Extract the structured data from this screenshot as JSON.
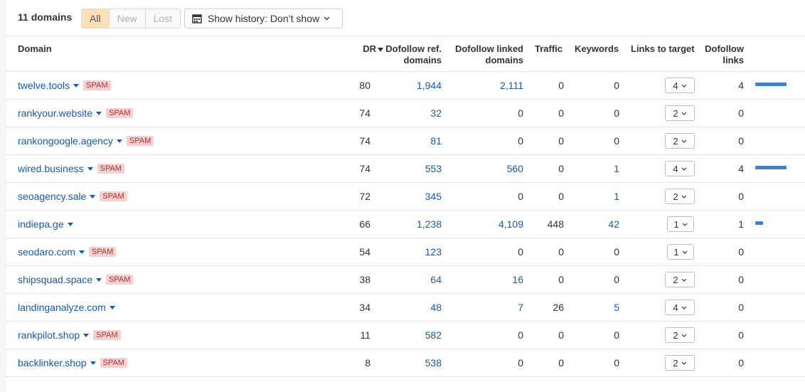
{
  "header": {
    "count_label": "11 domains",
    "filters": [
      {
        "label": "All",
        "active": true
      },
      {
        "label": "New",
        "active": false
      },
      {
        "label": "Lost",
        "active": false
      }
    ],
    "history_label": "Show history: Don’t show",
    "history_icon": "calendar-icon"
  },
  "columns": {
    "domain": "Domain",
    "dr": "DR",
    "dofollow_ref_domains_1": "Dofollow ref.",
    "dofollow_ref_domains_2": "domains",
    "dofollow_linked_domains_1": "Dofollow linked",
    "dofollow_linked_domains_2": "domains",
    "traffic": "Traffic",
    "keywords": "Keywords",
    "links_to_target": "Links to target",
    "dofollow_links_1": "Dofollow",
    "dofollow_links_2": "links"
  },
  "colors": {
    "link": "#1a5aa6",
    "spam_bg": "#f6d0d0",
    "active_filter_bg": "#fce0b5",
    "bar": "#3d84cc"
  },
  "rows": [
    {
      "domain": "twelve.tools",
      "spam": "SPAM",
      "dr": "80",
      "ref": "1,944",
      "linked": "2,111",
      "traffic": "0",
      "keywords": "0",
      "links_to_target": "4",
      "dofollow_links": "4",
      "dofollow_bar_fraction": 1.0
    },
    {
      "domain": "rankyour.website",
      "spam": "SPAM",
      "dr": "74",
      "ref": "32",
      "linked": "0",
      "traffic": "0",
      "keywords": "0",
      "links_to_target": "2",
      "dofollow_links": "0",
      "dofollow_bar_fraction": 0
    },
    {
      "domain": "rankongoogle.agency",
      "spam": "SPAM",
      "dr": "74",
      "ref": "81",
      "linked": "0",
      "traffic": "0",
      "keywords": "0",
      "links_to_target": "2",
      "dofollow_links": "0",
      "dofollow_bar_fraction": 0
    },
    {
      "domain": "wired.business",
      "spam": "SPAM",
      "dr": "74",
      "ref": "553",
      "linked": "560",
      "traffic": "0",
      "keywords": "1",
      "links_to_target": "4",
      "dofollow_links": "4",
      "dofollow_bar_fraction": 1.0
    },
    {
      "domain": "seoagency.sale",
      "spam": "SPAM",
      "dr": "72",
      "ref": "345",
      "linked": "0",
      "traffic": "0",
      "keywords": "1",
      "links_to_target": "2",
      "dofollow_links": "0",
      "dofollow_bar_fraction": 0
    },
    {
      "domain": "indiepa.ge",
      "spam": "",
      "dr": "66",
      "ref": "1,238",
      "linked": "4,109",
      "traffic": "448",
      "keywords": "42",
      "links_to_target": "1",
      "dofollow_links": "1",
      "dofollow_bar_fraction": 0.25
    },
    {
      "domain": "seodaro.com",
      "spam": "SPAM",
      "dr": "54",
      "ref": "123",
      "linked": "0",
      "traffic": "0",
      "keywords": "0",
      "links_to_target": "1",
      "dofollow_links": "0",
      "dofollow_bar_fraction": 0
    },
    {
      "domain": "shipsquad.space",
      "spam": "SPAM",
      "dr": "38",
      "ref": "64",
      "linked": "16",
      "traffic": "0",
      "keywords": "0",
      "links_to_target": "2",
      "dofollow_links": "0",
      "dofollow_bar_fraction": 0
    },
    {
      "domain": "landinganalyze.com",
      "spam": "",
      "dr": "34",
      "ref": "48",
      "linked": "7",
      "traffic": "26",
      "keywords": "5",
      "links_to_target": "4",
      "dofollow_links": "0",
      "dofollow_bar_fraction": 0
    },
    {
      "domain": "rankpilot.shop",
      "spam": "SPAM",
      "dr": "11",
      "ref": "582",
      "linked": "0",
      "traffic": "0",
      "keywords": "0",
      "links_to_target": "2",
      "dofollow_links": "0",
      "dofollow_bar_fraction": 0
    },
    {
      "domain": "backlinker.shop",
      "spam": "SPAM",
      "dr": "8",
      "ref": "538",
      "linked": "0",
      "traffic": "0",
      "keywords": "0",
      "links_to_target": "2",
      "dofollow_links": "0",
      "dofollow_bar_fraction": 0
    }
  ]
}
